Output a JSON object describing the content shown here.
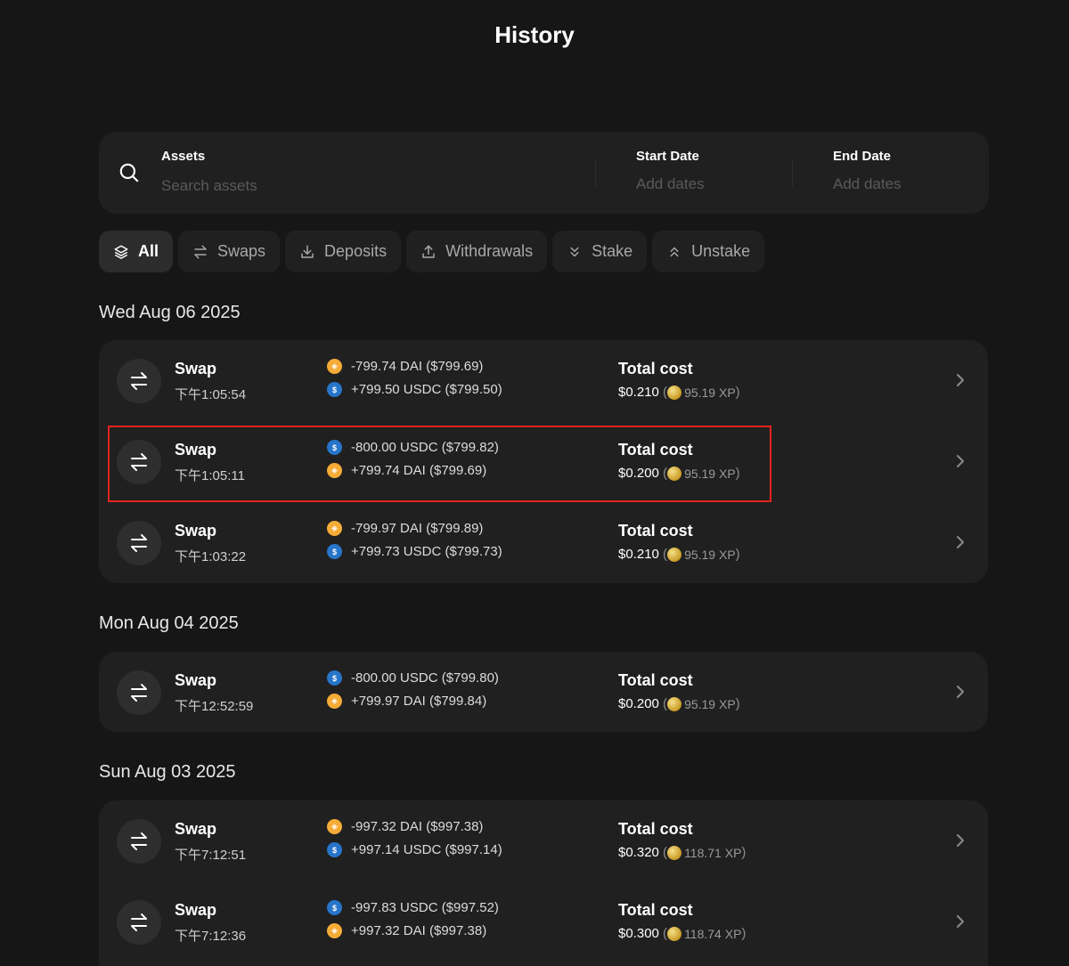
{
  "page": {
    "title": "History"
  },
  "search": {
    "assets_label": "Assets",
    "assets_placeholder": "Search assets",
    "start_date_label": "Start Date",
    "start_date_placeholder": "Add dates",
    "end_date_label": "End Date",
    "end_date_placeholder": "Add dates"
  },
  "filters": [
    {
      "label": "All",
      "icon": "layers-icon",
      "active": true
    },
    {
      "label": "Swaps",
      "icon": "swap-arrows-icon",
      "active": false
    },
    {
      "label": "Deposits",
      "icon": "download-icon",
      "active": false
    },
    {
      "label": "Withdrawals",
      "icon": "upload-icon",
      "active": false
    },
    {
      "label": "Stake",
      "icon": "chevrons-down-icon",
      "active": false
    },
    {
      "label": "Unstake",
      "icon": "chevrons-up-icon",
      "active": false
    }
  ],
  "groups": [
    {
      "date": "Wed Aug 06 2025",
      "rows": [
        {
          "type": "Swap",
          "time": "下午1:05:54",
          "amounts": [
            {
              "token": "DAI",
              "text": "-799.74 DAI ($799.69)"
            },
            {
              "token": "USDC",
              "text": "+799.50 USDC ($799.50)"
            }
          ],
          "cost_label": "Total cost",
          "cost": "$0.210",
          "xp": "95.19 XP"
        },
        {
          "type": "Swap",
          "time": "下午1:05:11",
          "amounts": [
            {
              "token": "USDC",
              "text": "-800.00 USDC ($799.82)"
            },
            {
              "token": "DAI",
              "text": "+799.74 DAI ($799.69)"
            }
          ],
          "cost_label": "Total cost",
          "cost": "$0.200",
          "xp": "95.19 XP"
        },
        {
          "type": "Swap",
          "time": "下午1:03:22",
          "amounts": [
            {
              "token": "DAI",
              "text": "-799.97 DAI ($799.89)"
            },
            {
              "token": "USDC",
              "text": "+799.73 USDC ($799.73)"
            }
          ],
          "cost_label": "Total cost",
          "cost": "$0.210",
          "xp": "95.19 XP"
        }
      ]
    },
    {
      "date": "Mon Aug 04 2025",
      "rows": [
        {
          "type": "Swap",
          "time": "下午12:52:59",
          "amounts": [
            {
              "token": "USDC",
              "text": "-800.00 USDC ($799.80)"
            },
            {
              "token": "DAI",
              "text": "+799.97 DAI ($799.84)"
            }
          ],
          "cost_label": "Total cost",
          "cost": "$0.200",
          "xp": "95.19 XP"
        }
      ]
    },
    {
      "date": "Sun Aug 03 2025",
      "rows": [
        {
          "type": "Swap",
          "time": "下午7:12:51",
          "amounts": [
            {
              "token": "DAI",
              "text": "-997.32 DAI ($997.38)"
            },
            {
              "token": "USDC",
              "text": "+997.14 USDC ($997.14)"
            }
          ],
          "cost_label": "Total cost",
          "cost": "$0.320",
          "xp": "118.71 XP"
        },
        {
          "type": "Swap",
          "time": "下午7:12:36",
          "amounts": [
            {
              "token": "USDC",
              "text": "-997.83 USDC ($997.52)"
            },
            {
              "token": "DAI",
              "text": "+997.32 DAI ($997.38)"
            }
          ],
          "cost_label": "Total cost",
          "cost": "$0.300",
          "xp": "118.74 XP"
        }
      ]
    }
  ],
  "colors": {
    "background": "#161616",
    "card": "#202020",
    "highlight_border": "#e5231f",
    "dai": "#f5ac37",
    "usdc": "#2775ca"
  }
}
